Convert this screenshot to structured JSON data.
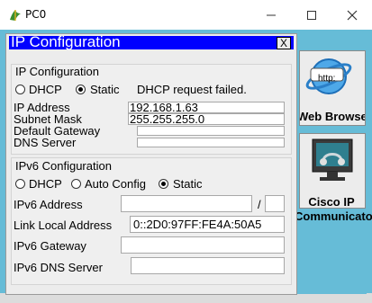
{
  "window": {
    "title": "PC0"
  },
  "dialog": {
    "title": "IP Configuration",
    "close_label": "X",
    "ipv4": {
      "heading": "IP Configuration",
      "dhcp_label": "DHCP",
      "static_label": "Static",
      "selected": "Static",
      "status_text": "DHCP request failed.",
      "ip_address_label": "IP Address",
      "ip_address_value": "192.168.1.63",
      "subnet_mask_label": "Subnet Mask",
      "subnet_mask_value": "255.255.255.0",
      "default_gateway_label": "Default Gateway",
      "default_gateway_value": "",
      "dns_server_label": "DNS Server",
      "dns_server_value": ""
    },
    "ipv6": {
      "heading": "IPv6 Configuration",
      "dhcp_label": "DHCP",
      "auto_config_label": "Auto Config",
      "static_label": "Static",
      "selected": "Static",
      "ipv6_address_label": "IPv6 Address",
      "ipv6_address_value": "",
      "prefix_separator": "/",
      "prefix_value": "",
      "link_local_label": "Link Local Address",
      "link_local_value": "0::2D0:97FF:FE4A:50A5",
      "gateway_label": "IPv6 Gateway",
      "gateway_value": "",
      "dns_server_label": "IPv6 DNS Server",
      "dns_server_value": ""
    }
  },
  "side_panel": {
    "web_browser_label": "Web Browser",
    "web_browser_icon_text": "http:",
    "cisco_ip_label": "Cisco IP",
    "cisco_ip_label_2": "Communicator"
  },
  "colors": {
    "dialog_title_bg": "#0000ff",
    "client_bg": "#66bcd7",
    "dialog_bg": "#ececec"
  }
}
